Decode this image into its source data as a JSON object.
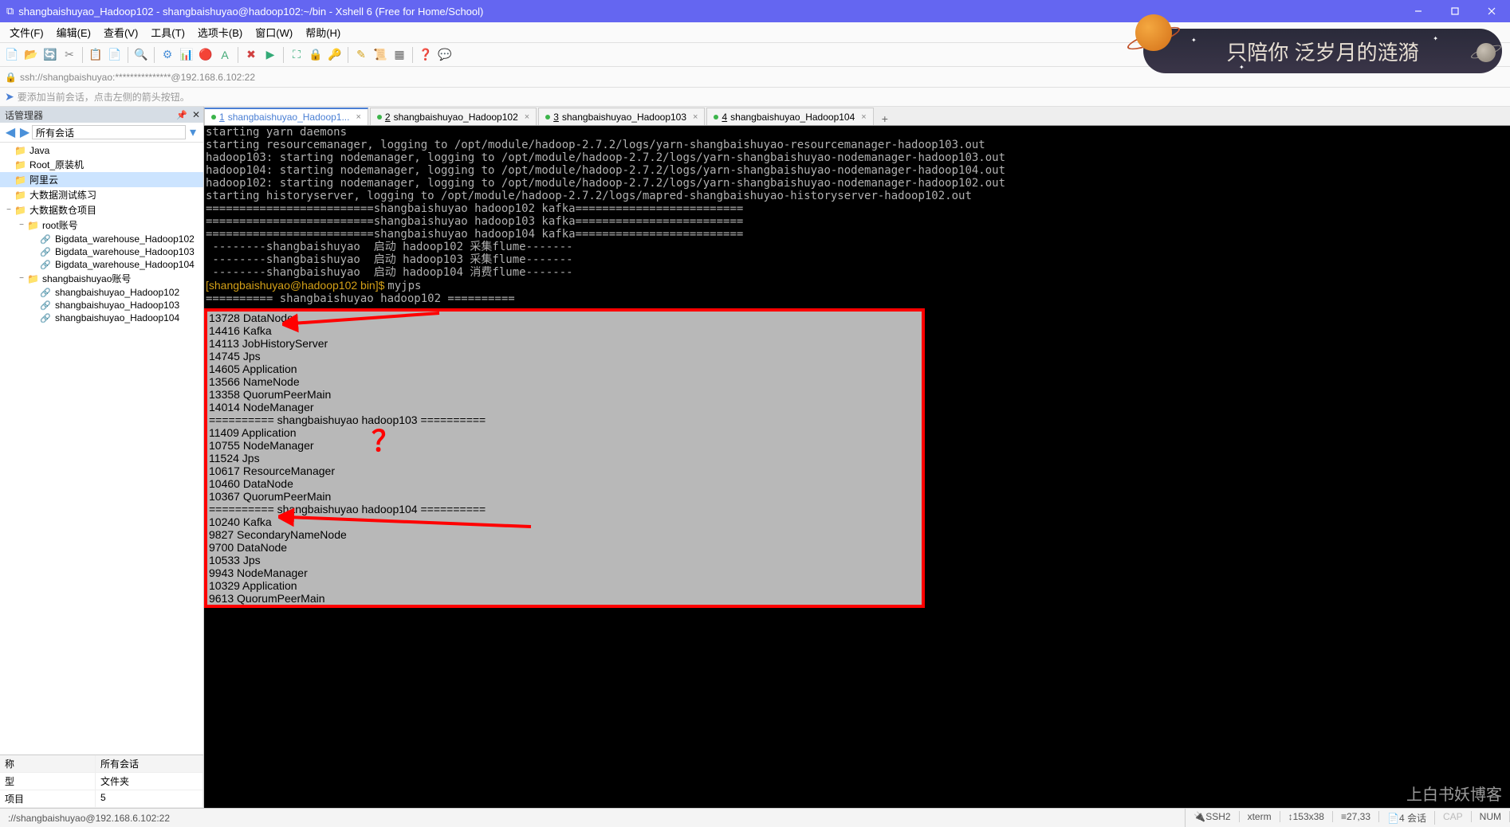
{
  "window": {
    "title": "shangbaishuyao_Hadoop102 - shangbaishuyao@hadoop102:~/bin - Xshell 6 (Free for Home/School)"
  },
  "menu": {
    "file": "文件(F)",
    "edit": "编辑(E)",
    "view": "查看(V)",
    "tools": "工具(T)",
    "tab": "选项卡(B)",
    "window": "窗口(W)",
    "help": "帮助(H)"
  },
  "address": {
    "text": "ssh://shangbaishuyao:***************@192.168.6.102:22"
  },
  "hint": {
    "text": "要添加当前会话，点击左侧的箭头按钮。"
  },
  "sidebar": {
    "title": "话管理器",
    "dropdown": "所有会话",
    "tree": [
      {
        "indent": 0,
        "toggle": "",
        "icon": "folder",
        "label": "Java"
      },
      {
        "indent": 0,
        "toggle": "",
        "icon": "folder",
        "label": "Root_原装机"
      },
      {
        "indent": 0,
        "toggle": "",
        "icon": "folder",
        "label": "阿里云",
        "selected": true
      },
      {
        "indent": 0,
        "toggle": "",
        "icon": "folder",
        "label": "大数据测试练习"
      },
      {
        "indent": 0,
        "toggle": "−",
        "icon": "folder",
        "label": "大数据数仓项目"
      },
      {
        "indent": 1,
        "toggle": "−",
        "icon": "folder",
        "label": "root账号"
      },
      {
        "indent": 2,
        "toggle": "",
        "icon": "session",
        "label": "Bigdata_warehouse_Hadoop102"
      },
      {
        "indent": 2,
        "toggle": "",
        "icon": "session",
        "label": "Bigdata_warehouse_Hadoop103"
      },
      {
        "indent": 2,
        "toggle": "",
        "icon": "session",
        "label": "Bigdata_warehouse_Hadoop104"
      },
      {
        "indent": 1,
        "toggle": "−",
        "icon": "folder",
        "label": "shangbaishuyao账号"
      },
      {
        "indent": 2,
        "toggle": "",
        "icon": "session",
        "label": "shangbaishuyao_Hadoop102"
      },
      {
        "indent": 2,
        "toggle": "",
        "icon": "session",
        "label": "shangbaishuyao_Hadoop103"
      },
      {
        "indent": 2,
        "toggle": "",
        "icon": "session",
        "label": "shangbaishuyao_Hadoop104"
      }
    ],
    "props": {
      "h1": "称",
      "h2": "所有会话",
      "r1c1": "型",
      "r1c2": "文件夹",
      "r2c1": "项目",
      "r2c2": "5"
    }
  },
  "tabs": [
    {
      "num": "1",
      "label": "shangbaishuyao_Hadoop1...",
      "active": true
    },
    {
      "num": "2",
      "label": "shangbaishuyao_Hadoop102"
    },
    {
      "num": "3",
      "label": "shangbaishuyao_Hadoop103"
    },
    {
      "num": "4",
      "label": "shangbaishuyao_Hadoop104"
    }
  ],
  "terminal": {
    "top_lines": [
      "starting yarn daemons",
      "starting resourcemanager, logging to /opt/module/hadoop-2.7.2/logs/yarn-shangbaishuyao-resourcemanager-hadoop103.out",
      "hadoop103: starting nodemanager, logging to /opt/module/hadoop-2.7.2/logs/yarn-shangbaishuyao-nodemanager-hadoop103.out",
      "hadoop104: starting nodemanager, logging to /opt/module/hadoop-2.7.2/logs/yarn-shangbaishuyao-nodemanager-hadoop104.out",
      "hadoop102: starting nodemanager, logging to /opt/module/hadoop-2.7.2/logs/yarn-shangbaishuyao-nodemanager-hadoop102.out",
      "starting historyserver, logging to /opt/module/hadoop-2.7.2/logs/mapred-shangbaishuyao-historyserver-hadoop102.out",
      "=========================shangbaishuyao hadoop102 kafka=========================",
      "=========================shangbaishuyao hadoop103 kafka=========================",
      "=========================shangbaishuyao hadoop104 kafka=========================",
      " --------shangbaishuyao  启动 hadoop102 采集flume-------",
      " --------shangbaishuyao  启动 hadoop103 采集flume-------",
      " --------shangbaishuyao  启动 hadoop104 消费flume-------"
    ],
    "prompt": "[shangbaishuyao@hadoop102 bin]$ ",
    "cmd": "myjps",
    "before_block": "========== shangbaishuyao hadoop102 ==========",
    "block": [
      "13728 DataNode",
      "14416 Kafka",
      "14113 JobHistoryServer",
      "14745 Jps",
      "14605 Application",
      "13566 NameNode",
      "13358 QuorumPeerMain",
      "14014 NodeManager",
      "========== shangbaishuyao hadoop103 ==========",
      "11409 Application",
      "10755 NodeManager",
      "11524 Jps",
      "10617 ResourceManager",
      "10460 DataNode",
      "10367 QuorumPeerMain",
      "========== shangbaishuyao hadoop104 ==========",
      "10240 Kafka",
      "9827 SecondaryNameNode",
      "9700 DataNode",
      "10533 Jps",
      "9943 NodeManager",
      "10329 Application",
      "9613 QuorumPeerMain"
    ]
  },
  "banner": {
    "text": "只陪你 泛岁月的涟漪"
  },
  "watermark": "上白书妖博客",
  "status": {
    "left": "://shangbaishuyao@192.168.6.102:22",
    "ssh": "SSH2",
    "term": "xterm",
    "size": "153x38",
    "pos": "27,33",
    "sess": "4 会话",
    "cap": "CAP",
    "num": "NUM"
  },
  "annotations": {
    "question_mark": "？"
  }
}
